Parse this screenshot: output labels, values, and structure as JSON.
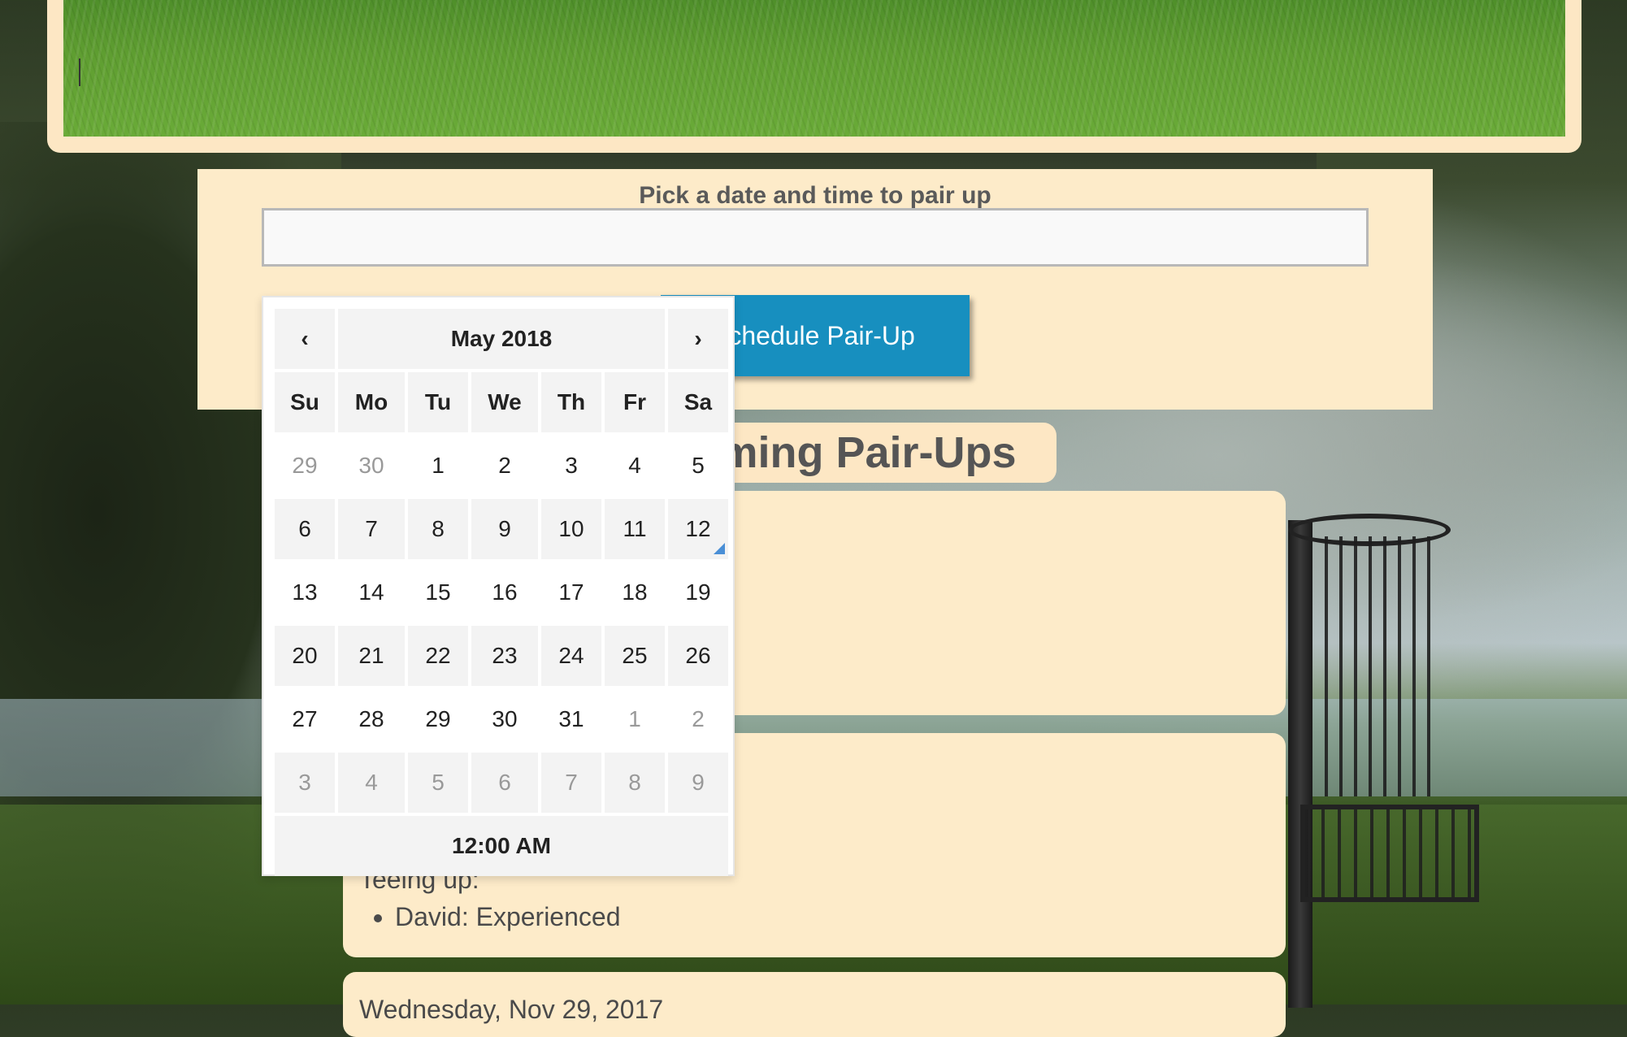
{
  "schedule": {
    "title": "Pick a date and time to pair up",
    "input_value": "",
    "button_label": "Schedule Pair-Up"
  },
  "upcoming": {
    "heading": "Upcoming Pair-Ups",
    "cards": [
      {},
      {
        "teeing_label": "Teeing up:",
        "players": [
          "David: Experienced"
        ]
      },
      {
        "date": "Wednesday, Nov 29, 2017"
      }
    ]
  },
  "datepicker": {
    "month_label": "May 2018",
    "prev_label": "‹",
    "next_label": "›",
    "weekdays": [
      "Su",
      "Mo",
      "Tu",
      "We",
      "Th",
      "Fr",
      "Sa"
    ],
    "weeks": [
      [
        "29",
        "30",
        "1",
        "2",
        "3",
        "4",
        "5"
      ],
      [
        "6",
        "7",
        "8",
        "9",
        "10",
        "11",
        "12"
      ],
      [
        "13",
        "14",
        "15",
        "16",
        "17",
        "18",
        "19"
      ],
      [
        "20",
        "21",
        "22",
        "23",
        "24",
        "25",
        "26"
      ],
      [
        "27",
        "28",
        "29",
        "30",
        "31",
        "1",
        "2"
      ],
      [
        "3",
        "4",
        "5",
        "6",
        "7",
        "8",
        "9"
      ]
    ],
    "time_label": "12:00 AM",
    "today_marker_color": "#4a8fd6"
  },
  "colors": {
    "panel": "#fdebc9",
    "button": "#178fbf"
  }
}
